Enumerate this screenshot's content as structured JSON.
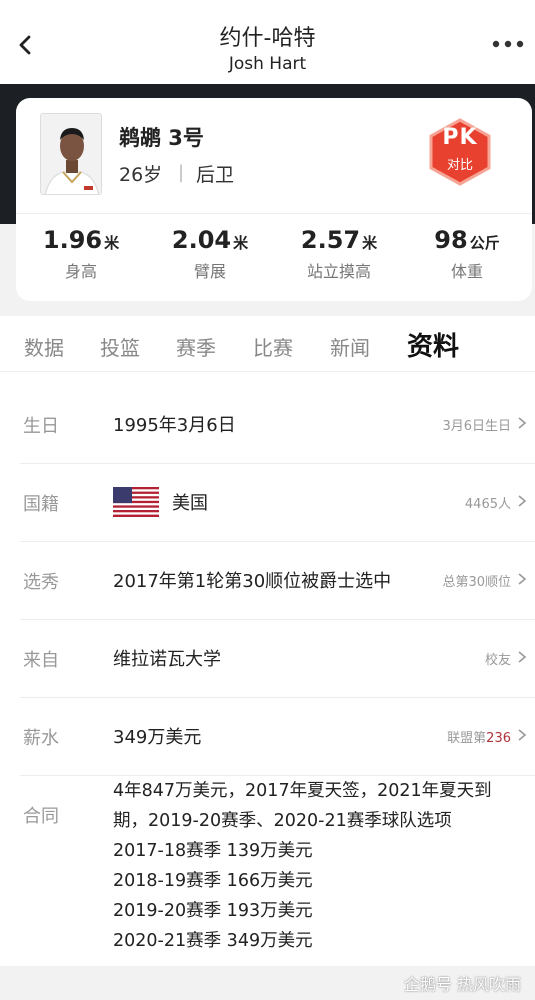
{
  "header": {
    "title": "约什-哈特",
    "subtitle": "Josh Hart"
  },
  "player": {
    "team_number": "鹈鹕 3号",
    "age": "26岁",
    "separator": "|",
    "position": "后卫",
    "pk_label": "PK",
    "pk_sub": "对比"
  },
  "stats": [
    {
      "value": "1.96",
      "unit": "米",
      "label": "身高"
    },
    {
      "value": "2.04",
      "unit": "米",
      "label": "臂展"
    },
    {
      "value": "2.57",
      "unit": "米",
      "label": "站立摸高"
    },
    {
      "value": "98",
      "unit": "公斤",
      "label": "体重"
    }
  ],
  "tabs": [
    "数据",
    "投篮",
    "赛季",
    "比赛",
    "新闻",
    "资料"
  ],
  "info": {
    "birthday": {
      "label": "生日",
      "value": "1995年3月6日",
      "right": "3月6日生日"
    },
    "nationality": {
      "label": "国籍",
      "value": "美国",
      "right": "4465人"
    },
    "draft": {
      "label": "选秀",
      "value": "2017年第1轮第30顺位被爵士选中",
      "right": "总第30顺位"
    },
    "college": {
      "label": "来自",
      "value": "维拉诺瓦大学",
      "right": "校友"
    },
    "salary": {
      "label": "薪水",
      "value": "349万美元",
      "right_prefix": "联盟第",
      "right_rank": "236"
    },
    "contract": {
      "label": "合同",
      "lines": [
        "4年847万美元，2017年夏天签，2021年夏天到",
        "期，2019-20赛季、2020-21赛季球队选项",
        "2017-18赛季 139万美元",
        "2018-19赛季 166万美元",
        "2019-20赛季 193万美元",
        "2020-21赛季 349万美元"
      ]
    }
  },
  "watermark": "企鹅号 热风吹雨",
  "colors": {
    "accent_red": "#b0323a",
    "pk_red": "#e8412f",
    "dark_band": "#1c1f24"
  },
  "icons": [
    "back-arrow-icon",
    "more-dots-icon",
    "chevron-right-icon",
    "us-flag-icon"
  ]
}
